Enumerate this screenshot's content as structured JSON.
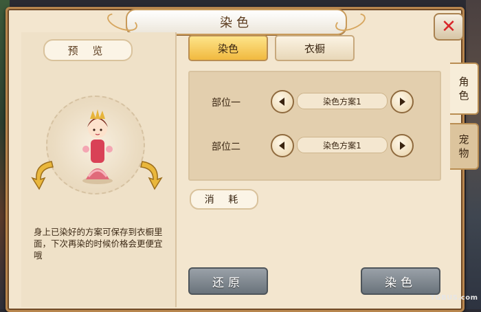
{
  "window": {
    "title": "染色"
  },
  "preview": {
    "label": "预 览",
    "info": "身上已染好的方案可保存到衣橱里面，下次再染的时候价格会更便宜哦"
  },
  "tabs": [
    {
      "label": "染色",
      "active": true
    },
    {
      "label": "衣橱",
      "active": false
    }
  ],
  "parts": [
    {
      "label": "部位一",
      "scheme": "染色方案1"
    },
    {
      "label": "部位二",
      "scheme": "染色方案1"
    }
  ],
  "consume": {
    "label": "消 耗"
  },
  "buttons": {
    "restore": "还原",
    "dye": "染色"
  },
  "side_tabs": [
    {
      "label": "角\n色",
      "active": true
    },
    {
      "label": "宠\n物",
      "active": false
    }
  ],
  "watermark": "TGBUS.com",
  "colors": {
    "accent": "#f1b93f",
    "panel": "#f3e6cf",
    "close": "#d8262a"
  },
  "icons": {
    "close": "close-icon",
    "arrow_left": "arrow-left-icon",
    "arrow_right": "arrow-right-icon",
    "rotate": "rotate-icon"
  }
}
